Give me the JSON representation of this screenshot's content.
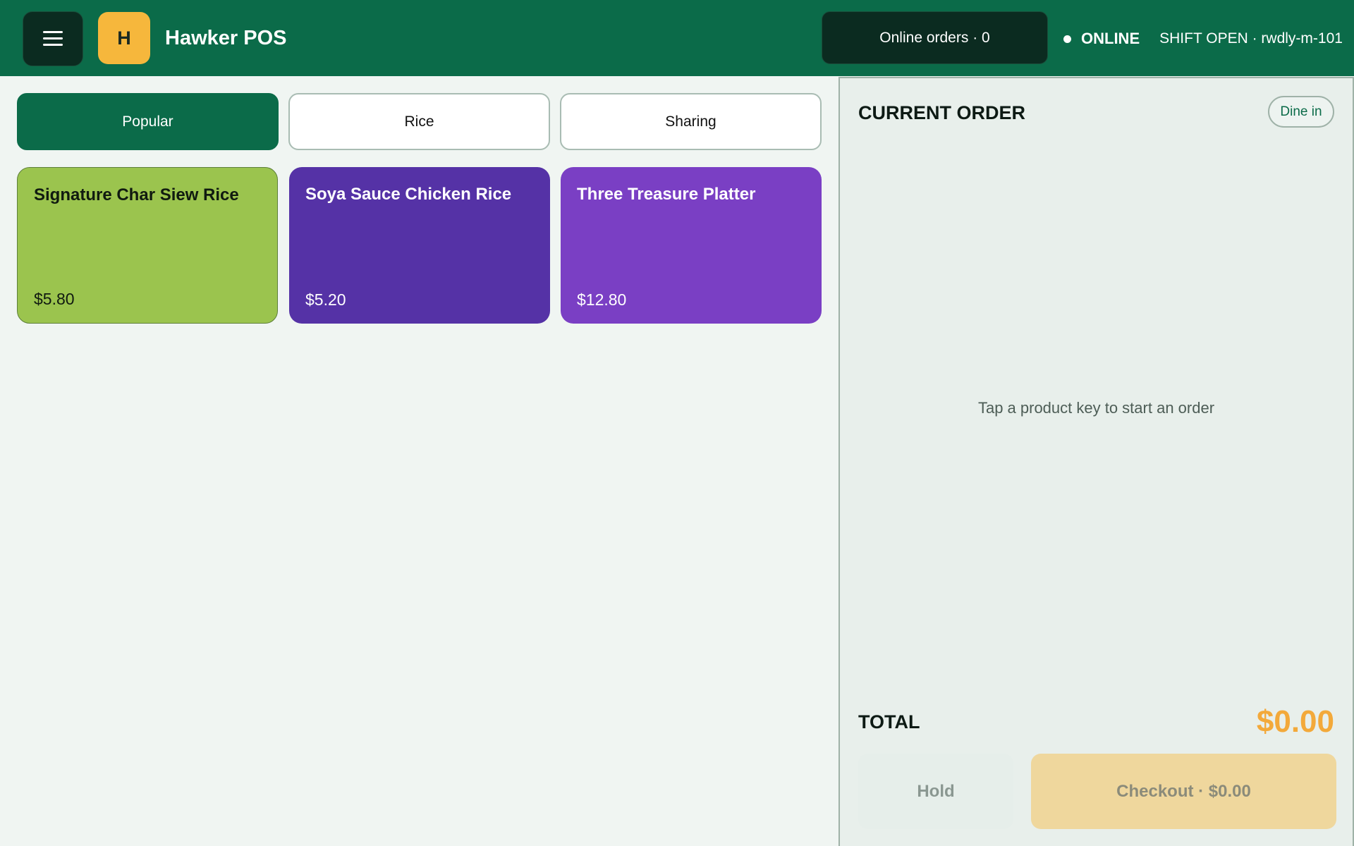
{
  "header": {
    "logo_letter": "H",
    "app_title": "Hawker POS",
    "online_orders": "Online orders · 0",
    "connection_status": "ONLINE",
    "shift_status": "SHIFT OPEN · rwdly-m-101"
  },
  "categories": [
    {
      "label": "Popular",
      "active": true
    },
    {
      "label": "Rice",
      "active": false
    },
    {
      "label": "Sharing",
      "active": false
    }
  ],
  "products": [
    {
      "name": "Signature Char Siew Rice",
      "price": "$5.80",
      "color": "#9bc44e"
    },
    {
      "name": "Soya Sauce Chicken Rice",
      "price": "$5.20",
      "color": "#5532a6"
    },
    {
      "name": "Three Treasure Platter",
      "price": "$12.80",
      "color": "#7a3fc4"
    }
  ],
  "order": {
    "title": "CURRENT ORDER",
    "order_type": "Dine in",
    "empty_message": "Tap a product key to start an order",
    "total_label": "TOTAL",
    "total_value": "$0.00",
    "hold_label": "Hold",
    "checkout_label": "Checkout · $0.00"
  },
  "colors": {
    "brand_green": "#0b6b49",
    "header_dark": "#0b2b20",
    "accent_orange": "#f6b73c",
    "total_orange": "#f3a93a"
  }
}
